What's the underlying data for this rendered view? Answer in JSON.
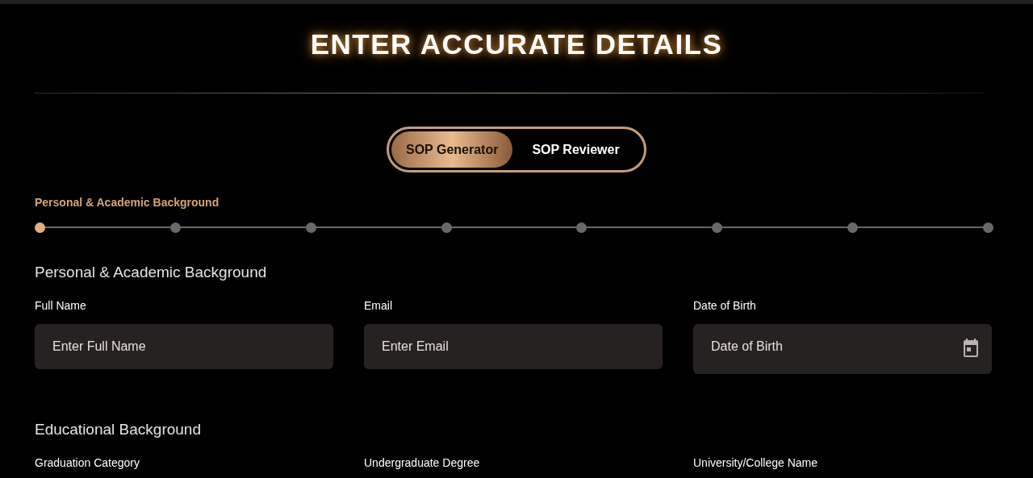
{
  "title": "ENTER ACCURATE DETAILS",
  "mode_tabs": [
    {
      "label": "SOP Generator",
      "selected": true
    },
    {
      "label": "SOP Reviewer",
      "selected": false
    }
  ],
  "stepper": {
    "current_label": "Personal & Academic Background",
    "steps": [
      {
        "selected": true
      },
      {
        "selected": false
      },
      {
        "selected": false
      },
      {
        "selected": false
      },
      {
        "selected": false
      },
      {
        "selected": false
      },
      {
        "selected": false
      },
      {
        "selected": false
      }
    ]
  },
  "sections": [
    {
      "heading": "Personal & Academic Background",
      "fields": [
        {
          "kind": "text",
          "label": "Full Name",
          "placeholder": "Enter Full Name"
        },
        {
          "kind": "text",
          "label": "Email",
          "placeholder": "Enter Email"
        },
        {
          "kind": "date",
          "label": "Date of Birth",
          "placeholder": "Date of Birth"
        }
      ]
    },
    {
      "heading": "Educational Background",
      "fields": [
        {
          "kind": "label",
          "label": "Graduation Category"
        },
        {
          "kind": "label",
          "label": "Undergraduate Degree"
        },
        {
          "kind": "label",
          "label": "University/College Name"
        }
      ]
    }
  ]
}
